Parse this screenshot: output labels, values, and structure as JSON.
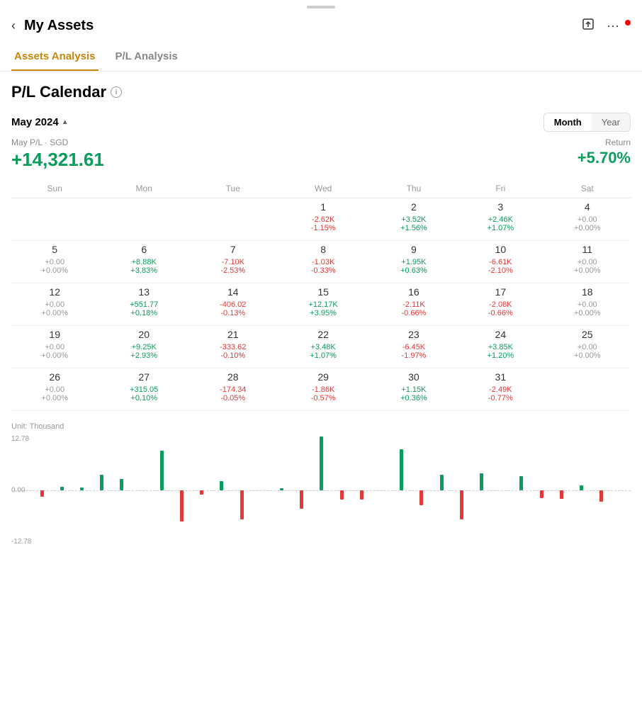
{
  "app": {
    "drag_handle": true,
    "title": "My Assets",
    "back_label": "‹",
    "export_icon": "⬡",
    "more_icon": "•••"
  },
  "tabs": [
    {
      "id": "assets",
      "label": "Assets Analysis",
      "active": true
    },
    {
      "id": "pl",
      "label": "P/L Analysis",
      "active": false
    }
  ],
  "calendar": {
    "title": "P/L Calendar",
    "info_icon": "i",
    "month_selector": "May 2024",
    "month_arrow": "▲",
    "toggle": {
      "month_label": "Month",
      "year_label": "Year",
      "active": "month"
    },
    "summary": {
      "label": "May P/L · SGD",
      "value": "+14,321.61",
      "return_label": "Return",
      "return_value": "+5.70%"
    },
    "weekdays": [
      "Sun",
      "Mon",
      "Tue",
      "Wed",
      "Thu",
      "Fri",
      "Sat"
    ],
    "weeks": [
      [
        {
          "day": "",
          "val": "",
          "pct": ""
        },
        {
          "day": "",
          "val": "",
          "pct": ""
        },
        {
          "day": "",
          "val": "",
          "pct": ""
        },
        {
          "day": "1",
          "val": "-2.62K",
          "pct": "-1.15%",
          "color": "red"
        },
        {
          "day": "2",
          "val": "+3.52K",
          "pct": "+1.56%",
          "color": "green"
        },
        {
          "day": "3",
          "val": "+2.46K",
          "pct": "+1.07%",
          "color": "green"
        },
        {
          "day": "4",
          "val": "+0.00",
          "pct": "+0.00%",
          "color": "gray"
        }
      ],
      [
        {
          "day": "5",
          "val": "+0.00",
          "pct": "+0.00%",
          "color": "gray"
        },
        {
          "day": "6",
          "val": "+8.88K",
          "pct": "+3.83%",
          "color": "green"
        },
        {
          "day": "7",
          "val": "-7.10K",
          "pct": "-2.53%",
          "color": "red"
        },
        {
          "day": "8",
          "val": "-1.03K",
          "pct": "-0.33%",
          "color": "red"
        },
        {
          "day": "9",
          "val": "+1.95K",
          "pct": "+0.63%",
          "color": "green"
        },
        {
          "day": "10",
          "val": "-6.61K",
          "pct": "-2.10%",
          "color": "red"
        },
        {
          "day": "11",
          "val": "+0.00",
          "pct": "+0.00%",
          "color": "gray"
        }
      ],
      [
        {
          "day": "12",
          "val": "+0.00",
          "pct": "+0.00%",
          "color": "gray"
        },
        {
          "day": "13",
          "val": "+551.77",
          "pct": "+0.18%",
          "color": "green"
        },
        {
          "day": "14",
          "val": "-406.02",
          "pct": "-0.13%",
          "color": "red"
        },
        {
          "day": "15",
          "val": "+12.17K",
          "pct": "+3.95%",
          "color": "green"
        },
        {
          "day": "16",
          "val": "-2.11K",
          "pct": "-0.66%",
          "color": "red"
        },
        {
          "day": "17",
          "val": "-2.08K",
          "pct": "-0.66%",
          "color": "red"
        },
        {
          "day": "18",
          "val": "+0.00",
          "pct": "+0.00%",
          "color": "gray"
        }
      ],
      [
        {
          "day": "19",
          "val": "+0.00",
          "pct": "+0.00%",
          "color": "gray"
        },
        {
          "day": "20",
          "val": "+9.25K",
          "pct": "+2.93%",
          "color": "green"
        },
        {
          "day": "21",
          "val": "-333.62",
          "pct": "-0.10%",
          "color": "red"
        },
        {
          "day": "22",
          "val": "+3.48K",
          "pct": "+1.07%",
          "color": "green"
        },
        {
          "day": "23",
          "val": "-6.45K",
          "pct": "-1.97%",
          "color": "red"
        },
        {
          "day": "24",
          "val": "+3.85K",
          "pct": "+1.20%",
          "color": "green"
        },
        {
          "day": "25",
          "val": "+0.00",
          "pct": "+0.00%",
          "color": "gray"
        }
      ],
      [
        {
          "day": "26",
          "val": "+0.00",
          "pct": "+0.00%",
          "color": "gray"
        },
        {
          "day": "27",
          "val": "+315.05",
          "pct": "+0.10%",
          "color": "green"
        },
        {
          "day": "28",
          "val": "-174.34",
          "pct": "-0.05%",
          "color": "red"
        },
        {
          "day": "29",
          "val": "-1.86K",
          "pct": "-0.57%",
          "color": "red"
        },
        {
          "day": "30",
          "val": "+1.15K",
          "pct": "+0.36%",
          "color": "green"
        },
        {
          "day": "31",
          "val": "-2.49K",
          "pct": "-0.77%",
          "color": "red"
        },
        {
          "day": "",
          "val": "",
          "pct": ""
        }
      ]
    ]
  },
  "chart": {
    "unit_label": "Unit: Thousand",
    "y_max": "12.78",
    "y_zero": "0.00",
    "y_min": "-12.78",
    "bars": [
      {
        "v": -1.5
      },
      {
        "v": 0.8
      },
      {
        "v": 0.6
      },
      {
        "v": 3.5
      },
      {
        "v": 2.5
      },
      {
        "v": 0
      },
      {
        "v": 8.9
      },
      {
        "v": -7.1
      },
      {
        "v": -1.0
      },
      {
        "v": 2.0
      },
      {
        "v": -6.6
      },
      {
        "v": 0
      },
      {
        "v": 0.5
      },
      {
        "v": -4.1
      },
      {
        "v": 12.2
      },
      {
        "v": -2.1
      },
      {
        "v": -2.1
      },
      {
        "v": 0
      },
      {
        "v": 9.2
      },
      {
        "v": -3.3
      },
      {
        "v": 3.5
      },
      {
        "v": -6.5
      },
      {
        "v": 3.9
      },
      {
        "v": 0
      },
      {
        "v": 3.2
      },
      {
        "v": -1.7
      },
      {
        "v": -1.9
      },
      {
        "v": 1.2
      },
      {
        "v": -2.5
      },
      {
        "v": 0
      }
    ]
  }
}
